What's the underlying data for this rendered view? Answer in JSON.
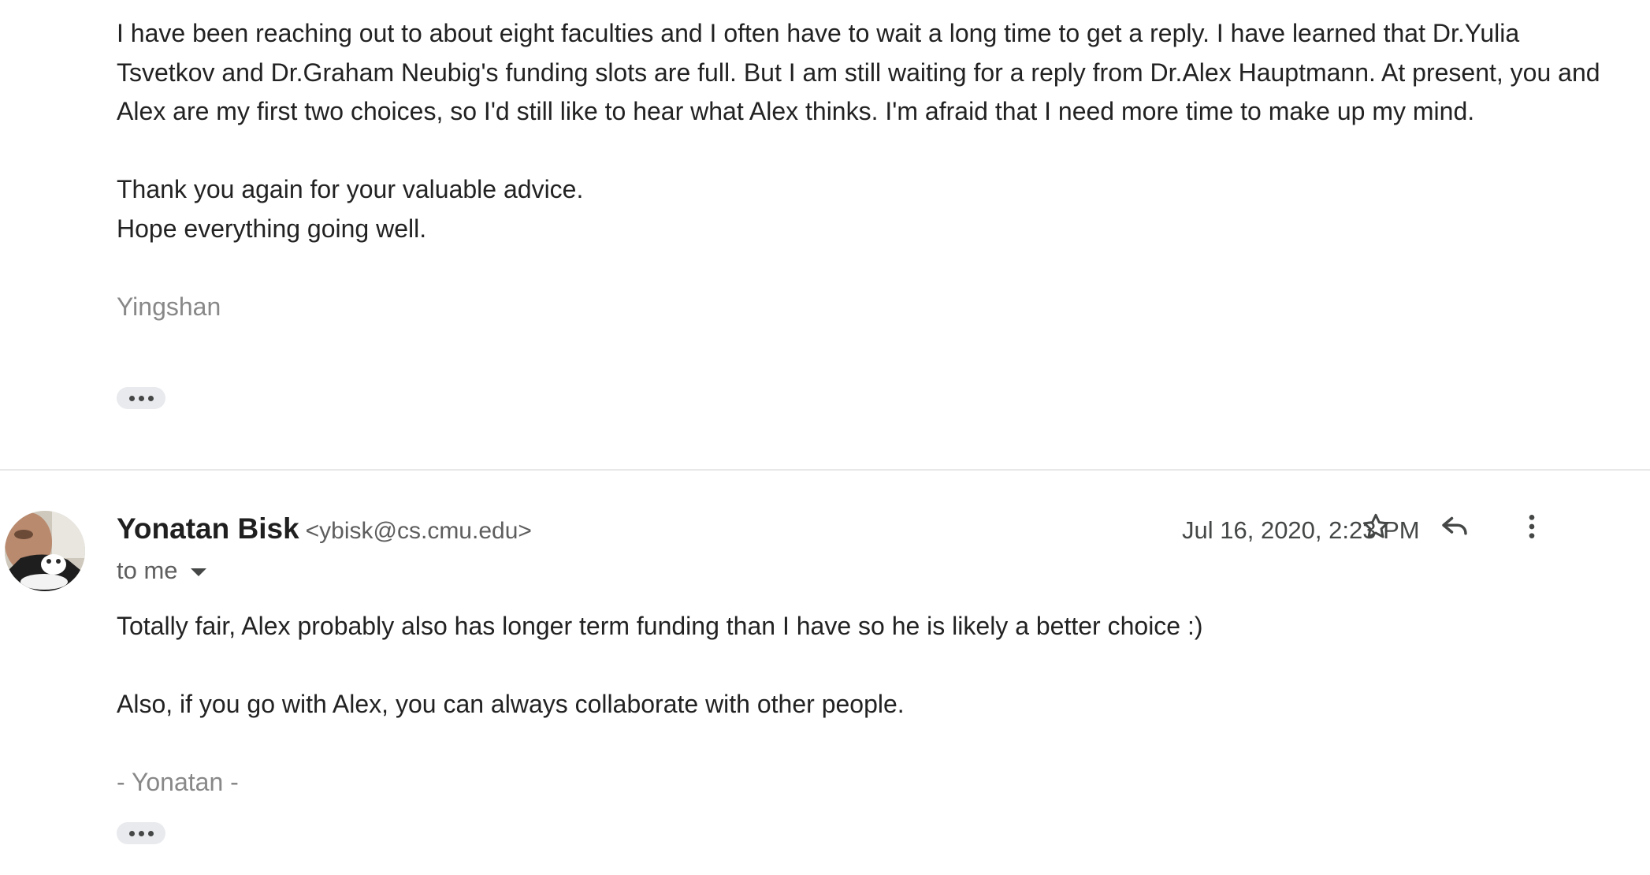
{
  "previous_message": {
    "paragraph1": [
      "I have been reaching out to about eight faculties and I often have to wait a long time to get a reply. I have learned that Dr.Yulia",
      "Tsvetkov and Dr.Graham Neubig's funding slots are full. But I am still waiting for a reply from Dr.Alex Hauptmann. At present, you and",
      "Alex are my first two choices, so I'd still like to hear what Alex thinks. I'm afraid that I need more time to make up my mind."
    ],
    "paragraph2": [
      "Thank you again for your valuable advice.",
      "Hope everything going well."
    ],
    "signature": "Yingshan",
    "show_trimmed_icon": "more-horiz-icon"
  },
  "message": {
    "sender_name": "Yonatan Bisk",
    "sender_email": "<ybisk@cs.cmu.edu>",
    "to_line": "to me",
    "date": "Jul 16, 2020, 2:23 PM",
    "icons": {
      "star": "star-icon",
      "reply": "reply-icon",
      "more": "more-vert-icon",
      "details": "chevron-down-icon"
    },
    "body": {
      "line1": "Totally fair, Alex probably also has longer term funding than I have so he is likely a better choice :)",
      "line2": "Also, if you go with Alex, you can always collaborate with other people.",
      "signature": "- Yonatan -"
    },
    "show_trimmed_icon": "more-horiz-icon"
  },
  "colors": {
    "text": "#222222",
    "signature": "#888888",
    "secondary": "#5e5e5e",
    "divider": "#e8e8e8",
    "chip_bg": "#e8eaed"
  }
}
